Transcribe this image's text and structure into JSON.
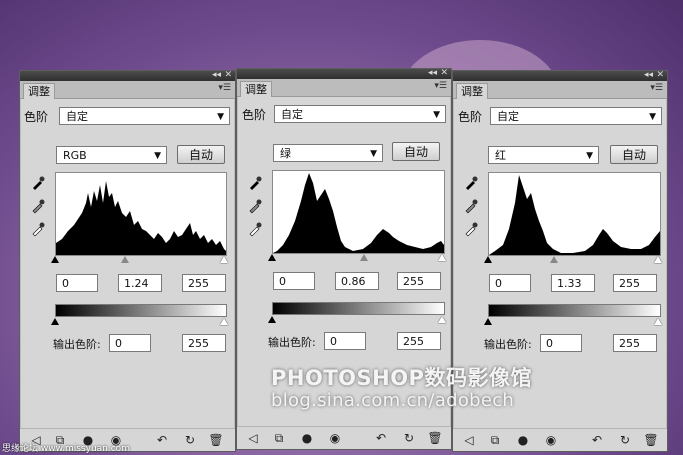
{
  "background": {
    "color": "#7b5698"
  },
  "panels": [
    {
      "tab": "调整",
      "preset_label": "色阶",
      "preset_value": "自定",
      "channel": "RGB",
      "auto_button": "自动",
      "input_black": "0",
      "input_gamma": "1.24",
      "input_white": "255",
      "output_label": "输出色阶:",
      "output_black": "0",
      "output_white": "255",
      "histogram": "rgb"
    },
    {
      "tab": "调整",
      "preset_label": "色阶",
      "preset_value": "自定",
      "channel": "绿",
      "auto_button": "自动",
      "input_black": "0",
      "input_gamma": "0.86",
      "input_white": "255",
      "output_label": "输出色阶:",
      "output_black": "0",
      "output_white": "255",
      "histogram": "green"
    },
    {
      "tab": "调整",
      "preset_label": "色阶",
      "preset_value": "自定",
      "channel": "红",
      "auto_button": "自动",
      "input_black": "0",
      "input_gamma": "1.33",
      "input_white": "255",
      "output_label": "输出色阶:",
      "output_black": "0",
      "output_white": "255",
      "histogram": "red"
    }
  ],
  "watermark": {
    "line1": "PHOTOSHOP数码影像馆",
    "line2": "blog.sina.com.cn/adobech"
  },
  "site_mark": "思缘论坛 www.missyuan.com",
  "icons": [
    "collapse-icon",
    "close-icon",
    "panel-menu-icon",
    "eyedropper-black-icon",
    "eyedropper-gray-icon",
    "eyedropper-white-icon",
    "back-arrow-icon",
    "clip-layer-icon",
    "visibility-icon",
    "eye-icon",
    "reset-previous-icon",
    "reset-icon",
    "trash-icon"
  ]
}
